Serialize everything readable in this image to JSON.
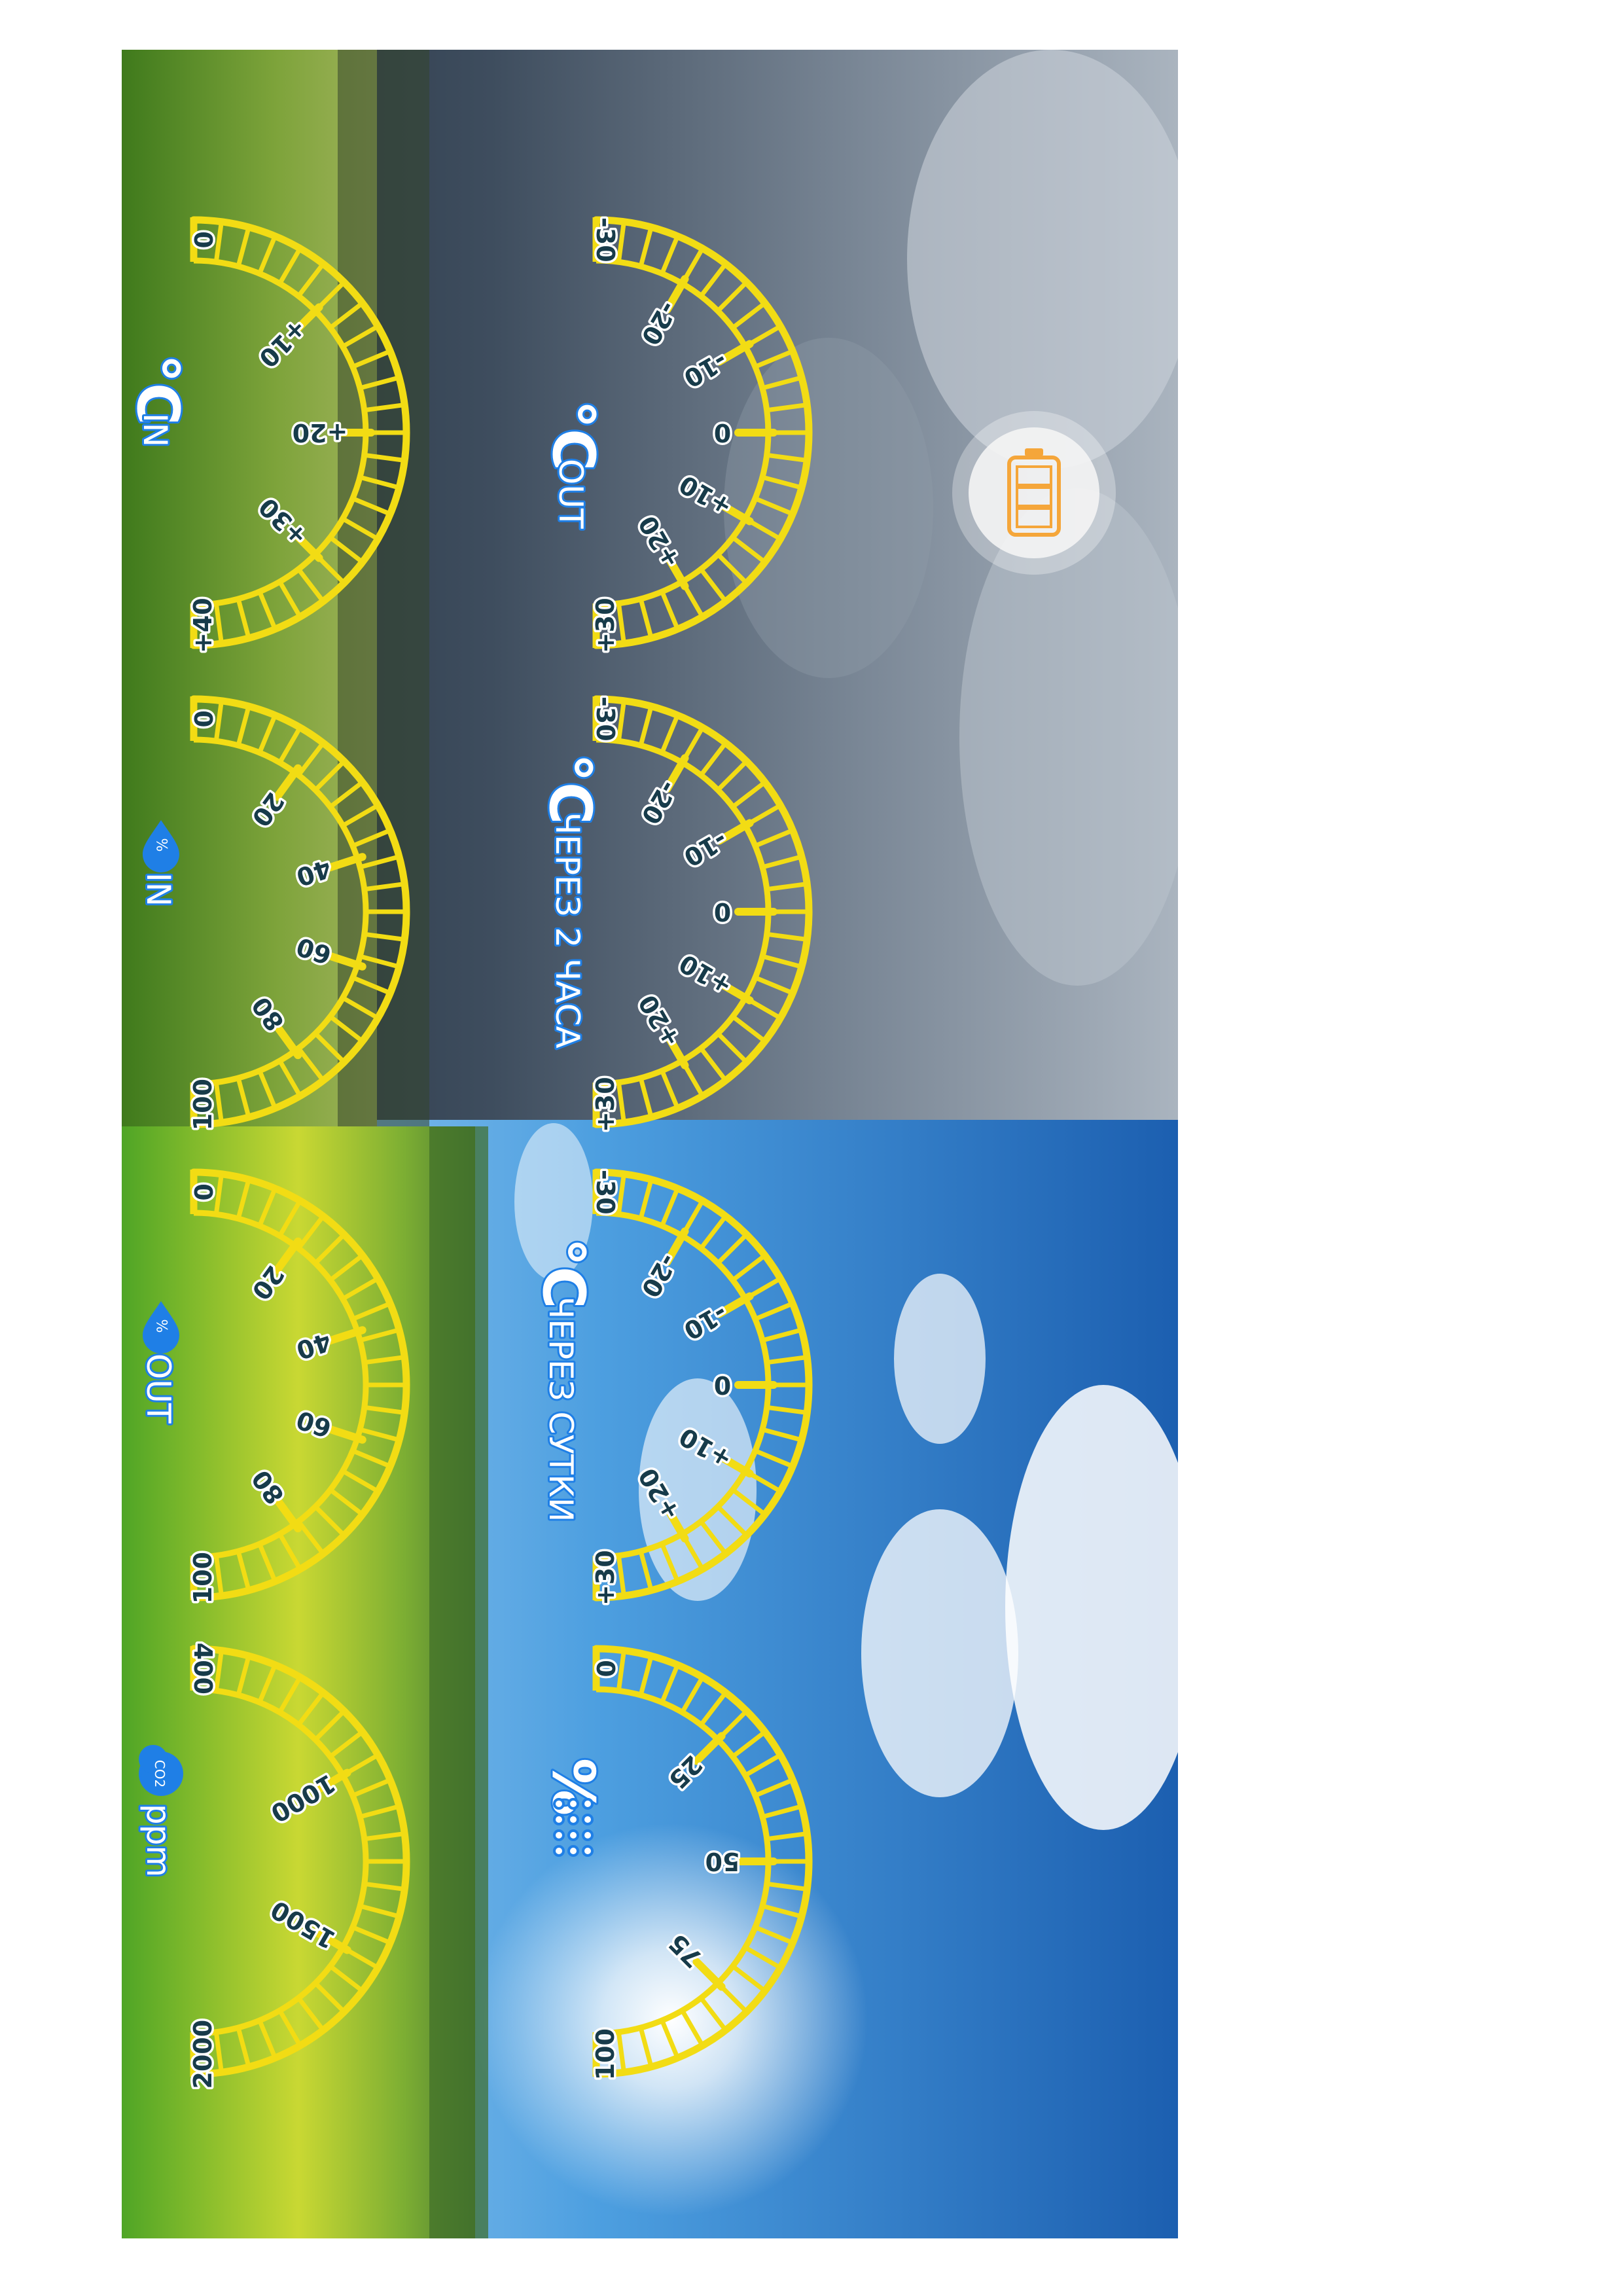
{
  "colors": {
    "gauge": "#f2dc14",
    "label_text": "#173b4a",
    "caption_fill": "#ffffff",
    "caption_outline": "#1f7fe6",
    "battery": "#f5a63a"
  },
  "battery": {
    "icon": "battery-icon"
  },
  "gauges": [
    {
      "key": "temp_in",
      "ticks": [
        "0",
        "+10",
        "+20",
        "+30",
        "+40"
      ],
      "caption": {
        "symbol": "°C",
        "text": "IN",
        "icon": ""
      }
    },
    {
      "key": "temp_out",
      "ticks": [
        "-30",
        "-20",
        "-10",
        "0",
        "+10",
        "+20",
        "+30"
      ],
      "caption": {
        "symbol": "°C",
        "text": "OUT",
        "icon": ""
      }
    },
    {
      "key": "humidity_in",
      "ticks": [
        "0",
        "20",
        "40",
        "60",
        "80",
        "100"
      ],
      "caption": {
        "symbol": "",
        "text": "IN",
        "icon": "humidity-drop-icon",
        "icon_text": "%"
      }
    },
    {
      "key": "forecast_2h",
      "ticks": [
        "-30",
        "-20",
        "-10",
        "0",
        "+10",
        "+20",
        "+30"
      ],
      "caption": {
        "symbol": "°C",
        "text": "ЧЕРЕЗ 2 ЧАСА",
        "icon": ""
      }
    },
    {
      "key": "humidity_out",
      "ticks": [
        "0",
        "20",
        "40",
        "60",
        "80",
        "100"
      ],
      "caption": {
        "symbol": "",
        "text": "OUT",
        "icon": "humidity-drop-icon",
        "icon_text": "%"
      }
    },
    {
      "key": "forecast_day",
      "ticks": [
        "-30",
        "-20",
        "-10",
        "0",
        "+10",
        "+20",
        "+30"
      ],
      "caption": {
        "symbol": "°C",
        "text": "ЧЕРЕЗ СУТКИ",
        "icon": ""
      }
    },
    {
      "key": "co2",
      "ticks": [
        "400",
        "1000",
        "1500",
        "2000"
      ],
      "caption": {
        "symbol": "",
        "text": "ppm",
        "icon": "co2-cloud-icon",
        "icon_text": "CO2"
      }
    },
    {
      "key": "precipitation",
      "ticks": [
        "0",
        "25",
        "50",
        "75",
        "100"
      ],
      "caption": {
        "symbol": "%",
        "text": "",
        "icon": "rain-drops-icon"
      }
    }
  ]
}
